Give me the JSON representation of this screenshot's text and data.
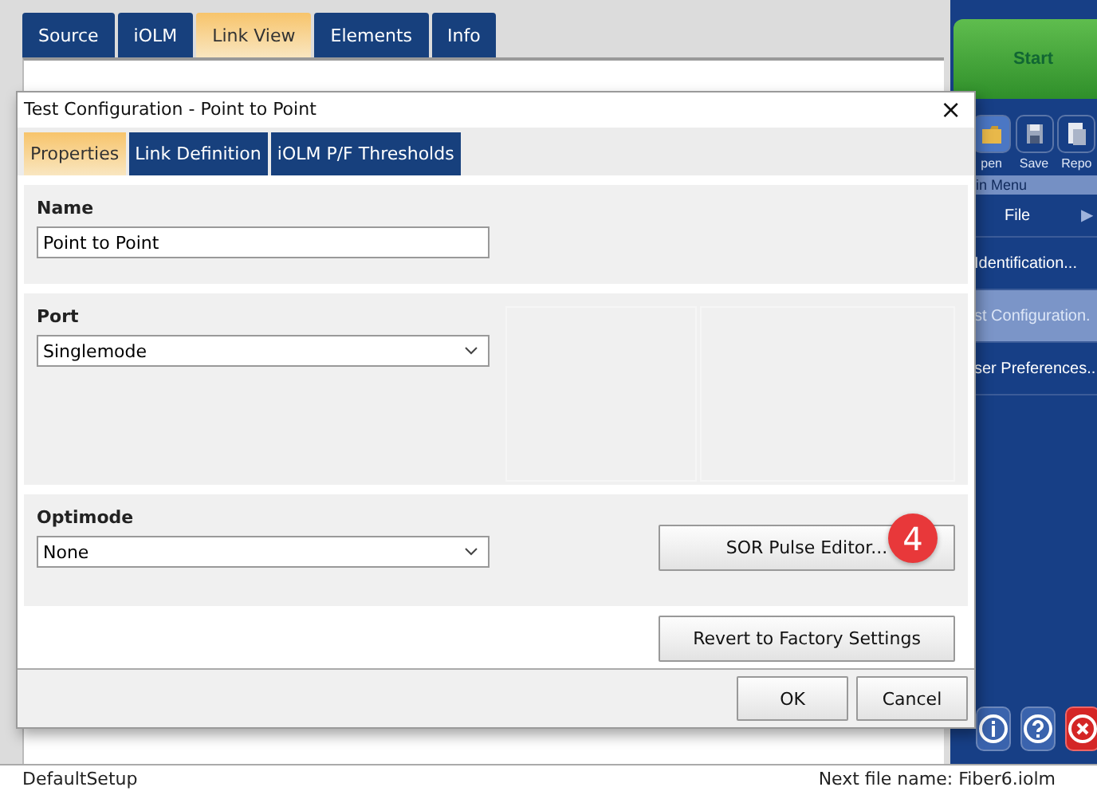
{
  "app_tabs": [
    {
      "label": "Source",
      "selected": false
    },
    {
      "label": "iOLM",
      "selected": false
    },
    {
      "label": "Link View",
      "selected": true
    },
    {
      "label": "Elements",
      "selected": false
    },
    {
      "label": "Info",
      "selected": false
    }
  ],
  "side_panel": {
    "start_button": "Start",
    "toolbar": [
      {
        "kind": "open",
        "label": "pen"
      },
      {
        "kind": "save",
        "label": "Save"
      },
      {
        "kind": "report",
        "label": "Repo"
      }
    ],
    "menu_header": "in Menu",
    "file_item": "File",
    "file_arrow": "▶",
    "menu_items": [
      {
        "label": "Identification...",
        "selected": false
      },
      {
        "label": "st Configuration.",
        "selected": true
      },
      {
        "label": "ser Preferences..",
        "selected": false
      }
    ],
    "bottom_icons": [
      {
        "kind": "info"
      },
      {
        "kind": "help"
      },
      {
        "kind": "exit"
      }
    ]
  },
  "dialog": {
    "title": "Test Configuration - Point to Point",
    "close": "×",
    "tabs": [
      {
        "label": "Properties",
        "selected": true
      },
      {
        "label": "Link Definition",
        "selected": false
      },
      {
        "label": "iOLM P/F Thresholds",
        "selected": false
      }
    ],
    "name": {
      "label": "Name",
      "value": "Point to Point"
    },
    "port": {
      "label": "Port",
      "value": "Singlemode"
    },
    "optimode": {
      "label": "Optimode",
      "value": "None"
    },
    "sor_button": "SOR Pulse Editor...",
    "badge": "4",
    "revert_button": "Revert to Factory Settings",
    "buttons": [
      "OK",
      "Cancel"
    ]
  },
  "status_bar": {
    "left": "DefaultSetup",
    "right": "Next file name: Fiber6.iolm"
  }
}
